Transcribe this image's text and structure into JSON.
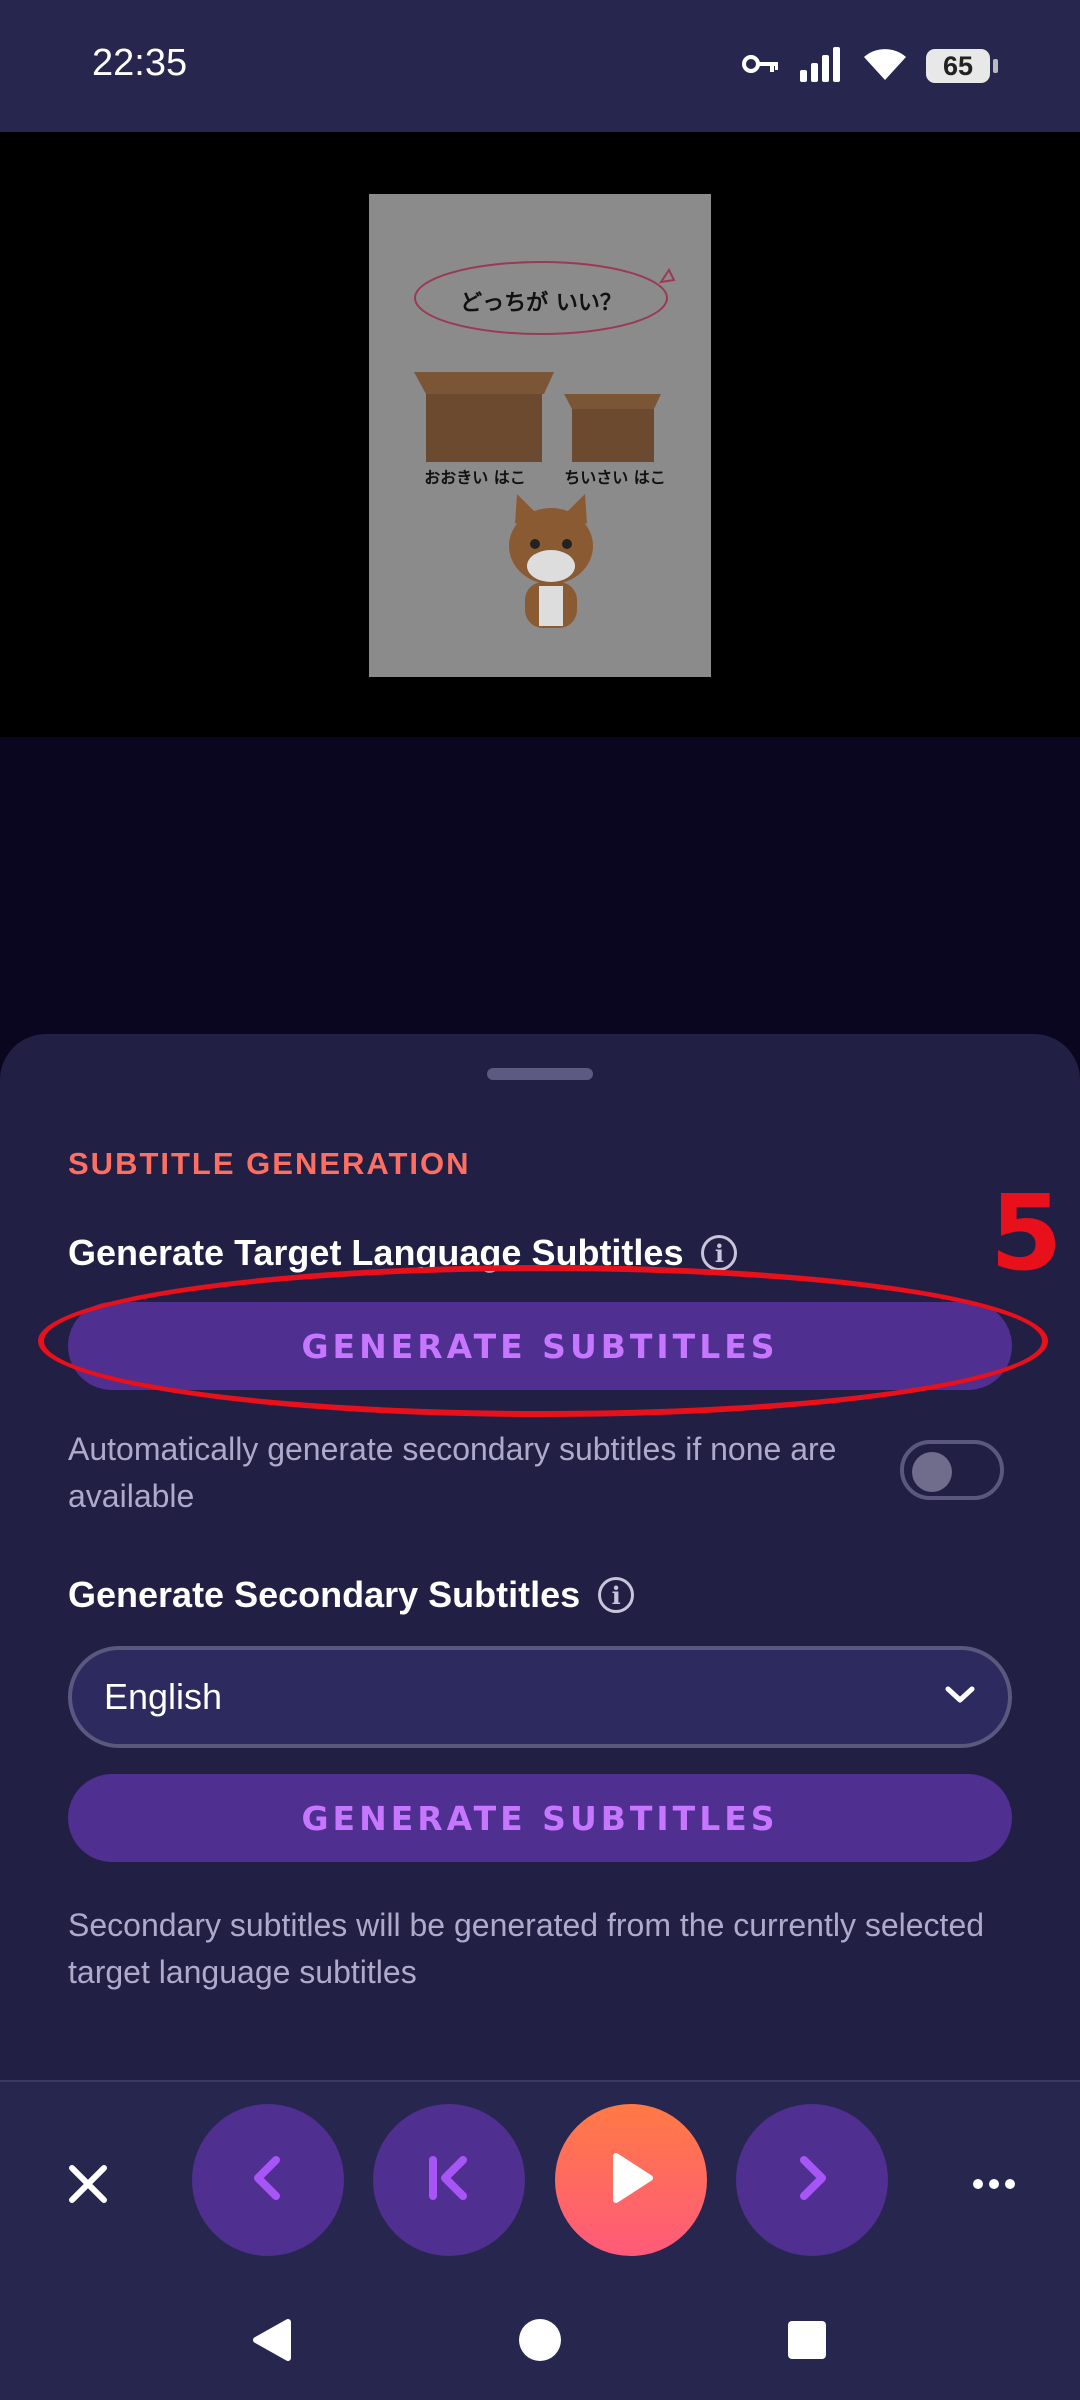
{
  "status_bar": {
    "time": "22:35",
    "battery": "65"
  },
  "video": {
    "speech_bubble": "どっちが いい？",
    "left_box_label": "おおきい はこ",
    "right_box_label": "ちいさい はこ"
  },
  "sheet": {
    "section_title": "SUBTITLE GENERATION",
    "target": {
      "title": "Generate Target Language Subtitles",
      "button_label": "GENERATE SUBTITLES"
    },
    "auto_secondary": {
      "text": "Automatically generate secondary subtitles if none are available",
      "enabled": false
    },
    "secondary": {
      "title": "Generate Secondary Subtitles",
      "language": "English",
      "button_label": "GENERATE SUBTITLES",
      "note": "Secondary subtitles will be generated from the currently selected target language subtitles"
    },
    "annotation": {
      "number": "5",
      "color": "#e8101a"
    }
  },
  "colors": {
    "accent": "#ff6f61",
    "button_bg": "#4f2f8f",
    "button_text": "#c777ff",
    "play_gradient_start": "#ff7a45",
    "play_gradient_end": "#ff5a7a"
  },
  "player_controls": [
    "close-icon",
    "chevron-left-icon",
    "skip-back-icon",
    "play-icon",
    "chevron-right-icon",
    "more-icon"
  ],
  "nav": [
    "back-icon",
    "home-icon",
    "recents-icon"
  ]
}
